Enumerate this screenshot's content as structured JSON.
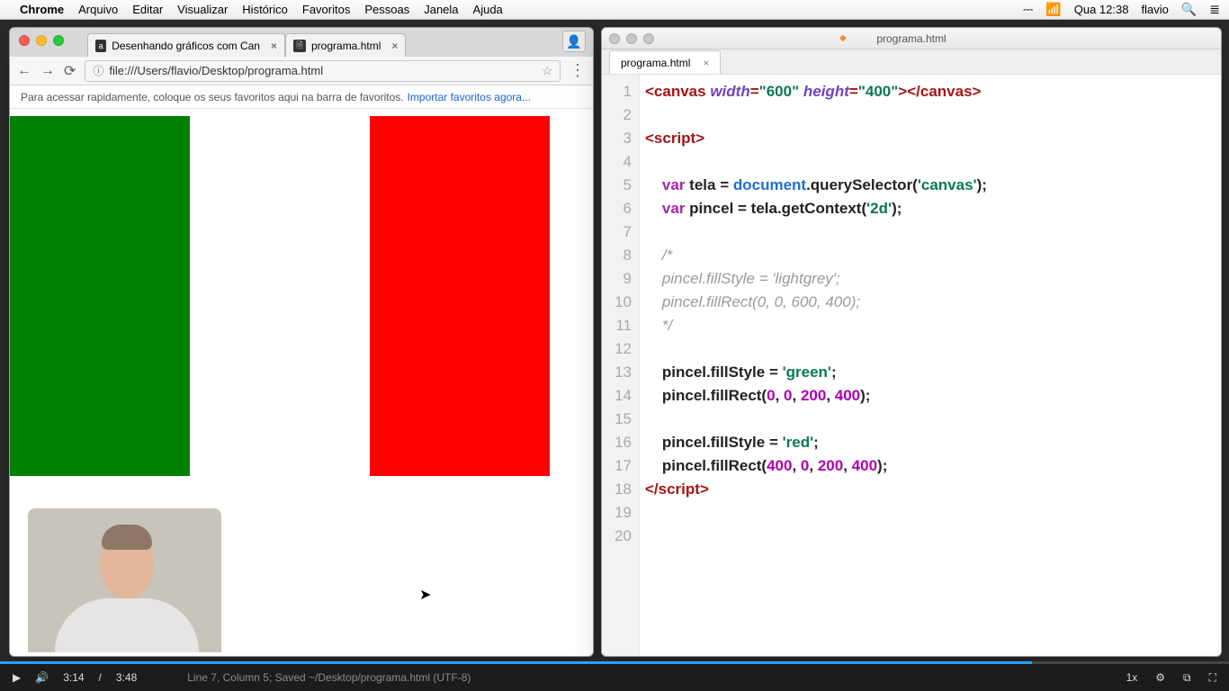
{
  "menubar": {
    "apple": "",
    "app": "Chrome",
    "items": [
      "Arquivo",
      "Editar",
      "Visualizar",
      "Histórico",
      "Favoritos",
      "Pessoas",
      "Janela",
      "Ajuda"
    ],
    "right": {
      "battery_icon": "⎓",
      "wifi_icon": "📶",
      "clock": "Qua 12:38",
      "user": "flavio",
      "search_icon": "🔍",
      "menu_icon": "≣"
    }
  },
  "chrome": {
    "tabs": [
      {
        "favicon": "a",
        "title": "Desenhando gráficos com Can"
      },
      {
        "favicon": "🗎",
        "title": "programa.html"
      }
    ],
    "nav": {
      "back": "←",
      "forward": "→",
      "reload": "⟳"
    },
    "url_icon": "ⓘ",
    "url": "file:///Users/flavio/Desktop/programa.html",
    "star": "☆",
    "kebab": "⋮",
    "bookmark_hint": "Para acessar rapidamente, coloque os seus favoritos aqui na barra de favoritos.",
    "bookmark_link": "Importar favoritos agora...",
    "user_icon": "👤"
  },
  "editor": {
    "window_title": "programa.html",
    "file_tab": "programa.html",
    "line_count": 20,
    "code": [
      {
        "n": 1,
        "html": "<span class='tag'>&lt;canvas</span> <span class='attr'>width</span><span class='tag'>=</span><span class='str'>\"600\"</span> <span class='attr'>height</span><span class='tag'>=</span><span class='str'>\"400\"</span><span class='tag'>&gt;&lt;/canvas&gt;</span>"
      },
      {
        "n": 2,
        "html": ""
      },
      {
        "n": 3,
        "html": "<span class='tag'>&lt;script&gt;</span>"
      },
      {
        "n": 4,
        "html": ""
      },
      {
        "n": 5,
        "html": "    <span class='kw'>var</span> <span class='plain'>tela = </span><span class='obj'>document</span><span class='plain'>.querySelector(</span><span class='str'>'canvas'</span><span class='plain'>);</span>"
      },
      {
        "n": 6,
        "html": "    <span class='kw'>var</span> <span class='plain'>pincel = tela.getContext(</span><span class='str'>'2d'</span><span class='plain'>);</span>"
      },
      {
        "n": 7,
        "html": ""
      },
      {
        "n": 8,
        "html": "    <span class='cmt'>/*</span>"
      },
      {
        "n": 9,
        "html": "    <span class='cmt'>pincel.fillStyle = 'lightgrey';</span>"
      },
      {
        "n": 10,
        "html": "    <span class='cmt'>pincel.fillRect(0, 0, 600, 400);</span>"
      },
      {
        "n": 11,
        "html": "    <span class='cmt'>*/</span>"
      },
      {
        "n": 12,
        "html": ""
      },
      {
        "n": 13,
        "html": "    <span class='plain'>pincel.fillStyle = </span><span class='str'>'green'</span><span class='plain'>;</span>"
      },
      {
        "n": 14,
        "html": "    <span class='plain'>pincel.fillRect(</span><span class='num'>0</span><span class='plain'>, </span><span class='num'>0</span><span class='plain'>, </span><span class='num'>200</span><span class='plain'>, </span><span class='num'>400</span><span class='plain'>);</span>"
      },
      {
        "n": 15,
        "html": ""
      },
      {
        "n": 16,
        "html": "    <span class='plain'>pincel.fillStyle = </span><span class='str'>'red'</span><span class='plain'>;</span>"
      },
      {
        "n": 17,
        "html": "    <span class='plain'>pincel.fillRect(</span><span class='num'>400</span><span class='plain'>, </span><span class='num'>0</span><span class='plain'>, </span><span class='num'>200</span><span class='plain'>, </span><span class='num'>400</span><span class='plain'>);</span>"
      },
      {
        "n": 18,
        "html": "<span class='tag'>&lt;/script&gt;</span>"
      },
      {
        "n": 19,
        "html": ""
      },
      {
        "n": 20,
        "html": ""
      }
    ]
  },
  "video": {
    "play": "▶",
    "volume": "🔊",
    "current": "3:14",
    "sep": "/",
    "duration": "3:48",
    "status": "Line 7, Column 5; Saved ~/Desktop/programa.html (UTF-8)",
    "speed": "1x",
    "settings": "⚙",
    "pip": "⧉",
    "full": "⛶"
  }
}
